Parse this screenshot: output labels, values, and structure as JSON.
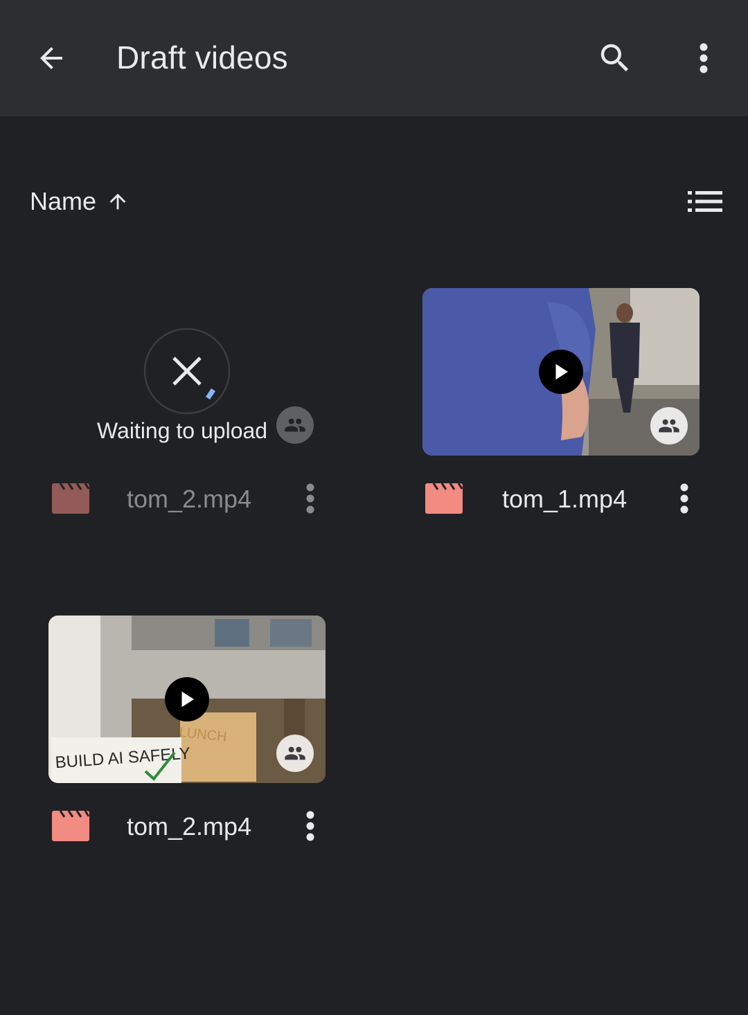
{
  "header": {
    "title": "Draft videos",
    "back_icon": "arrow-left-icon",
    "search_icon": "search-icon",
    "more_icon": "more-vert-icon"
  },
  "sort": {
    "label": "Name",
    "direction_icon": "arrow-up-icon",
    "view_icon": "list-view-icon"
  },
  "files": [
    {
      "name": "tom_2.mp4",
      "status": "Waiting to upload",
      "shared": true,
      "type_icon": "video-file-icon"
    },
    {
      "name": "tom_1.mp4",
      "shared": true,
      "type_icon": "video-file-icon"
    },
    {
      "name": "tom_2.mp4",
      "shared": true,
      "type_icon": "video-file-icon",
      "thumbnail_text": [
        "BUILD AI SAFELY",
        "LUNCH"
      ]
    }
  ],
  "colors": {
    "background": "#202124",
    "toolbar": "#2d2e31",
    "video_icon": "#f28b82",
    "upload_progress": "#8ab4f8"
  }
}
